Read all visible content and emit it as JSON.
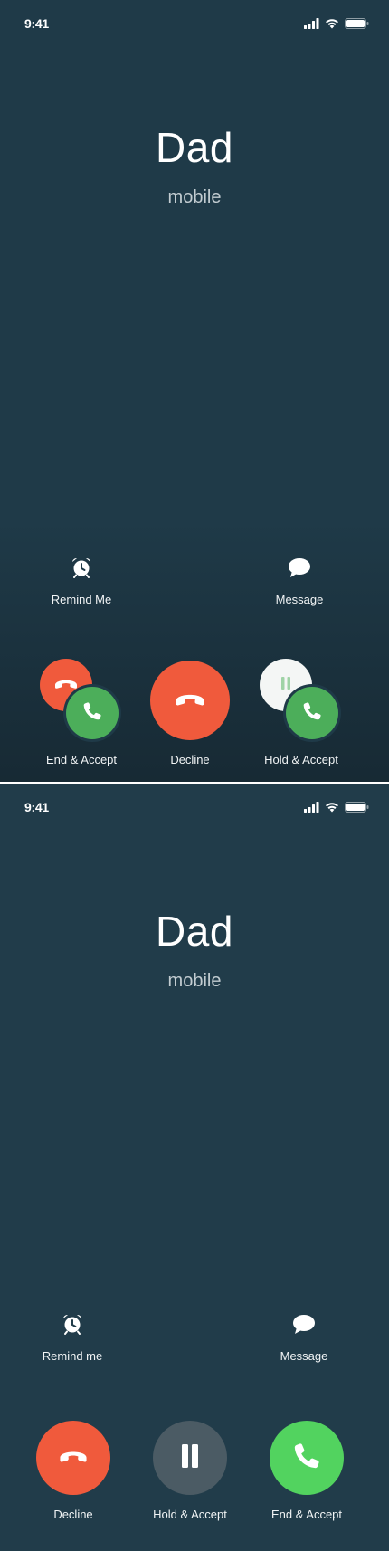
{
  "screens": [
    {
      "status_bar": {
        "time": "9:41",
        "icons": [
          "signal-icon",
          "wifi-icon",
          "battery-icon"
        ]
      },
      "caller": {
        "name": "Dad",
        "label": "mobile"
      },
      "quick_actions": {
        "remind": {
          "label": "Remind Me",
          "icon": "alarm-clock-icon"
        },
        "message": {
          "label": "Message",
          "icon": "speech-bubble-icon"
        }
      },
      "call_actions": {
        "end_accept": {
          "label": "End & Accept",
          "icons": [
            "phone-hangup-icon",
            "phone-icon"
          ]
        },
        "decline": {
          "label": "Decline",
          "icon": "phone-hangup-icon"
        },
        "hold_accept": {
          "label": "Hold & Accept",
          "icons": [
            "pause-icon",
            "phone-icon"
          ]
        }
      }
    },
    {
      "status_bar": {
        "time": "9:41",
        "icons": [
          "signal-icon",
          "wifi-icon",
          "battery-icon"
        ]
      },
      "caller": {
        "name": "Dad",
        "label": "mobile"
      },
      "quick_actions": {
        "remind": {
          "label": "Remind me",
          "icon": "alarm-clock-icon"
        },
        "message": {
          "label": "Message",
          "icon": "speech-bubble-icon"
        }
      },
      "call_actions": {
        "decline": {
          "label": "Decline",
          "icon": "phone-hangup-icon"
        },
        "hold_accept": {
          "label": "Hold & Accept",
          "icon": "pause-icon"
        },
        "end_accept": {
          "label": "End & Accept",
          "icon": "phone-icon"
        }
      }
    }
  ],
  "colors": {
    "background_1": "#1f3a48",
    "background_2": "#213c4a",
    "decline_red": "#f05a3c",
    "accept_green": "#4cae5a",
    "accept_green_bright": "#52d35f",
    "hold_gray": "#4b5b64",
    "hold_white": "#f4f6f5"
  }
}
